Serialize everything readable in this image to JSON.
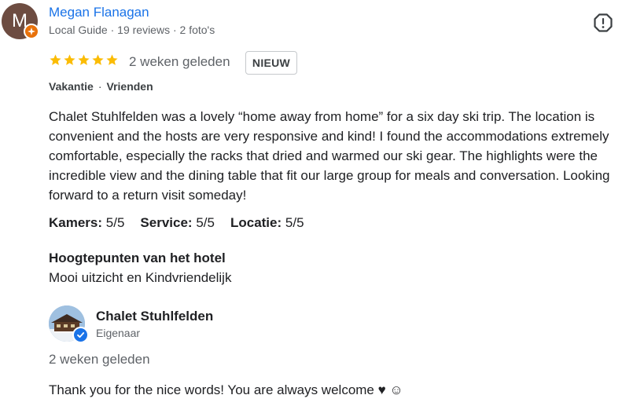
{
  "reviewer": {
    "avatar_letter": "M",
    "name": "Megan Flanagan",
    "meta": "Local Guide · 19 reviews · 2 foto's"
  },
  "review": {
    "stars": 5,
    "time": "2 weken geleden",
    "badge": "NIEUW",
    "tags": [
      "Vakantie",
      "Vrienden"
    ],
    "text": "Chalet Stuhlfelden was a lovely “home away from home” for a six day ski trip. The location is convenient and the hosts are very responsive and kind! I found the accommodations extremely comfortable, especially the racks that dried and warmed our ski gear. The highlights were the incredible view and the dining table that fit our large group for meals and conversation. Looking forward to a return visit someday!",
    "ratings": [
      {
        "label": "Kamers:",
        "value": "5/5"
      },
      {
        "label": "Service:",
        "value": "5/5"
      },
      {
        "label": "Locatie:",
        "value": "5/5"
      }
    ],
    "highlights_title": "Hoogtepunten van het hotel",
    "highlights_text": "Mooi uitzicht en Kindvriendelijk"
  },
  "owner_reply": {
    "name": "Chalet Stuhlfelden",
    "role": "Eigenaar",
    "time": "2 weken geleden",
    "text": "Thank you for the nice words! You are always welcome ♥ ☺"
  },
  "colors": {
    "name_link": "#1a73e8",
    "star": "#fbbc04",
    "local_guide_badge": "#e8710a",
    "verified": "#1a73e8"
  },
  "icons": {
    "report": "report-flag-icon",
    "star": "star-icon",
    "verified": "verified-check-icon",
    "local_guide": "local-guide-badge-icon"
  }
}
